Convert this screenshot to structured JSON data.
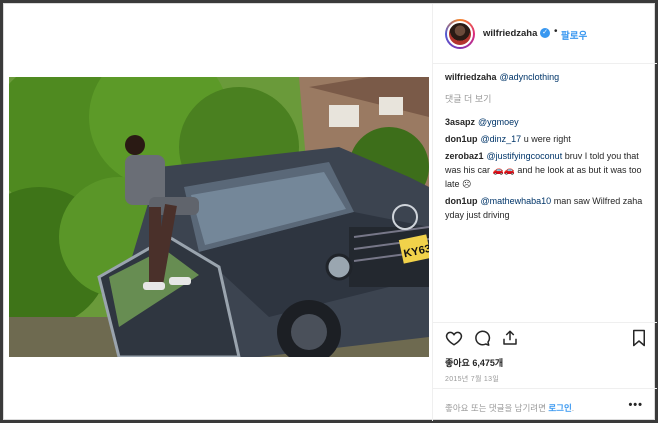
{
  "header": {
    "username": "wilfriedzaha",
    "verified_glyph": "✓",
    "separator": "•",
    "follow_label": "팔로우"
  },
  "caption": {
    "user": "wilfriedzaha",
    "mention": "@adynclothing"
  },
  "load_more_label": "댓글 더 보기",
  "comments": [
    {
      "user": "3asapz",
      "mention": "@ygmoey",
      "text": ""
    },
    {
      "user": "don1up",
      "mention": "@dinz_17",
      "text": "u were right"
    },
    {
      "user": "zerobaz1",
      "mention": "@justifyingcoconut",
      "text": "bruv I told you that was his car 🚗🚗 and he look at as but it was too late ☹"
    },
    {
      "user": "don1up",
      "mention": "@mathewhaba10",
      "text": "man saw Wilfred zaha yday just driving"
    }
  ],
  "likes_label": "좋아요 6,475개",
  "date_label": "2015년 7월 13일",
  "comment_prompt": "좋아요 또는 댓글을 남기려면",
  "login_label": "로그인",
  "login_suffix": ".",
  "more_glyph": "•••",
  "photo": {
    "plate_text": "KY63"
  },
  "icons": [
    "heart-icon",
    "comment-icon",
    "share-icon",
    "bookmark-icon"
  ],
  "colors": {
    "accent": "#3897f0",
    "text": "#262626",
    "muted": "#999999"
  }
}
